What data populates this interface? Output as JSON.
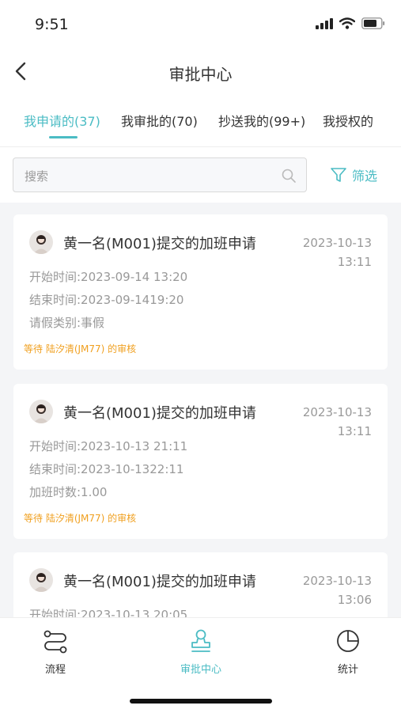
{
  "status": {
    "time": "9:51"
  },
  "nav": {
    "title": "审批中心"
  },
  "tabs": [
    {
      "label": "我申请的(37)",
      "active": true
    },
    {
      "label": "我审批的(70)",
      "active": false
    },
    {
      "label": "抄送我的(99+)",
      "active": false
    },
    {
      "label": "我授权的",
      "active": false
    }
  ],
  "search": {
    "placeholder": "搜索",
    "filter_label": "筛选"
  },
  "cards": [
    {
      "title": "黄一名(M001)提交的加班申请",
      "date": "2023-10-13",
      "time": "13:11",
      "rows": [
        "开始时间:2023-09-14 13:20",
        "结束时间:2023-09-1419:20",
        "请假类别:事假"
      ],
      "waiting": "等待 陆汐清(JM77) 的审核"
    },
    {
      "title": "黄一名(M001)提交的加班申请",
      "date": "2023-10-13",
      "time": "13:11",
      "rows": [
        "开始时间:2023-10-13 21:11",
        "结束时间:2023-10-1322:11",
        "加班时数:1.00"
      ],
      "waiting": "等待 陆汐清(JM77) 的审核"
    },
    {
      "title": "黄一名(M001)提交的加班申请",
      "date": "2023-10-13",
      "time": "13:06",
      "rows": [
        "开始时间:2023-10-13 20:05"
      ],
      "waiting": ""
    }
  ],
  "bottom_nav": [
    {
      "label": "流程",
      "icon": "flow-icon",
      "active": false
    },
    {
      "label": "审批中心",
      "icon": "stamp-icon",
      "active": true
    },
    {
      "label": "统计",
      "icon": "pie-chart-icon",
      "active": false
    }
  ],
  "colors": {
    "accent": "#4bbcc4",
    "waiting": "#f0a020",
    "muted": "#999999",
    "background": "#f4f5f7"
  }
}
